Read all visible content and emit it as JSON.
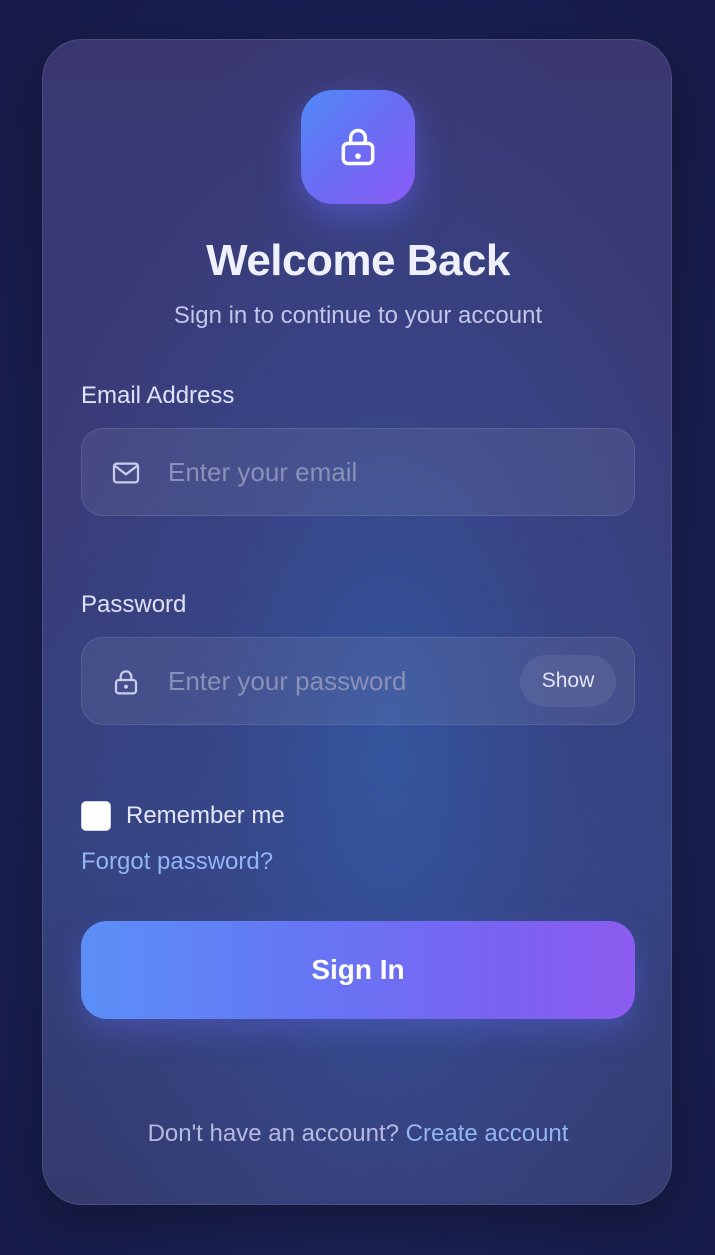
{
  "header": {
    "logo_icon": "lock-icon",
    "title": "Welcome Back",
    "subtitle": "Sign in to continue to your account"
  },
  "form": {
    "email": {
      "label": "Email Address",
      "icon": "mail-icon",
      "value": "",
      "placeholder": "Enter your email"
    },
    "password": {
      "label": "Password",
      "icon": "lock-icon",
      "value": "",
      "placeholder": "Enter your password",
      "toggle_label": "Show"
    },
    "remember": {
      "label": "Remember me",
      "checked": false
    },
    "forgot_label": "Forgot password?",
    "submit_label": "Sign In"
  },
  "footer": {
    "prompt": "Don't have an account?",
    "link_label": "Create account"
  },
  "colors": {
    "accent_start": "#5b8ff7",
    "accent_end": "#8c5cf0",
    "link": "#93b4f5"
  }
}
